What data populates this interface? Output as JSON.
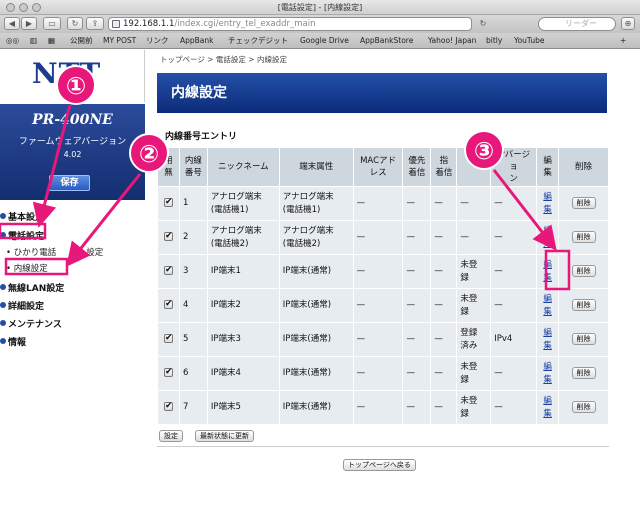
{
  "window": {
    "title": "[電話設定] - [内線設定]"
  },
  "toolbar": {
    "url": "192.168.1.1",
    "url_path": "/index.cgi/entry_tel_exaddr_main",
    "search_placeholder": "リーダー"
  },
  "bookmarks": [
    "公開前",
    "MY POST",
    "リンク",
    "AppBank",
    "チェックデジット",
    "Google Drive",
    "AppBankStore",
    "Yahoo! Japan",
    "bitly",
    "YouTube"
  ],
  "sidebar": {
    "logo": "NTT",
    "model": "PR-400NE",
    "fw_label": "ファームウェアバージョン",
    "fw_version": "4.02",
    "save_label": "保存",
    "nav": [
      "基本設定",
      "電話設定",
      "無線LAN設定",
      "詳細設定",
      "メンテナンス",
      "情報"
    ],
    "sub": [
      "ひかり電話",
      "設定",
      "内線設定"
    ]
  },
  "main": {
    "breadcrumb": "トップページ > 電話設定 > 内線設定",
    "title": "内線設定",
    "section": "内線番号エントリ",
    "headers": {
      "use1": "用",
      "use2": "無",
      "num1": "内線",
      "num2": "番号",
      "nick": "ニックネーム",
      "attr": "端末属性",
      "mac1": "MACアド",
      "mac2": "レス",
      "prio1": "優先",
      "prio2": "着信",
      "sh1": "指",
      "sh2": "着信",
      "reg": "",
      "ipv": "IPバージョ",
      "ipv2": "ン",
      "edit1": "編",
      "edit2": "集",
      "del": "削除"
    },
    "rows": [
      {
        "num": "1",
        "nick1": "アナログ端末",
        "nick2": "(電話機1)",
        "attr1": "アナログ端末",
        "attr2": "(電話機1)",
        "mac": "—",
        "prio": "—",
        "sh": "—",
        "reg1": "—",
        "reg2": "",
        "ipv": "—",
        "edit1": "編",
        "edit2": "集",
        "del": "削除"
      },
      {
        "num": "2",
        "nick1": "アナログ端末",
        "nick2": "(電話機2)",
        "attr1": "アナログ端末",
        "attr2": "(電話機2)",
        "mac": "—",
        "prio": "—",
        "sh": "—",
        "reg1": "—",
        "reg2": "",
        "ipv": "—",
        "edit1": "編",
        "edit2": "集",
        "del": "削除"
      },
      {
        "num": "3",
        "nick1": "IP端末1",
        "nick2": "",
        "attr1": "IP端末(通常)",
        "attr2": "",
        "mac": "—",
        "prio": "—",
        "sh": "—",
        "reg1": "未登",
        "reg2": "録",
        "ipv": "—",
        "edit1": "編",
        "edit2": "集",
        "del": "削除"
      },
      {
        "num": "4",
        "nick1": "IP端末2",
        "nick2": "",
        "attr1": "IP端末(通常)",
        "attr2": "",
        "mac": "—",
        "prio": "—",
        "sh": "—",
        "reg1": "未登",
        "reg2": "録",
        "ipv": "—",
        "edit1": "編",
        "edit2": "集",
        "del": "削除"
      },
      {
        "num": "5",
        "nick1": "IP端末3",
        "nick2": "",
        "attr1": "IP端末(通常)",
        "attr2": "",
        "mac": "—",
        "prio": "—",
        "sh": "—",
        "reg1": "登録",
        "reg2": "済み",
        "ipv": "IPv4",
        "edit1": "編",
        "edit2": "集",
        "del": "削除"
      },
      {
        "num": "6",
        "nick1": "IP端末4",
        "nick2": "",
        "attr1": "IP端末(通常)",
        "attr2": "",
        "mac": "—",
        "prio": "—",
        "sh": "—",
        "reg1": "未登",
        "reg2": "録",
        "ipv": "—",
        "edit1": "編",
        "edit2": "集",
        "del": "削除"
      },
      {
        "num": "7",
        "nick1": "IP端末5",
        "nick2": "",
        "attr1": "IP端末(通常)",
        "attr2": "",
        "mac": "—",
        "prio": "—",
        "sh": "—",
        "reg1": "未登",
        "reg2": "録",
        "ipv": "—",
        "edit1": "編",
        "edit2": "集",
        "del": "削除"
      }
    ],
    "set_label": "設定",
    "refresh_label": "最新状態に更新",
    "back_label": "トップページへ戻る"
  },
  "annotations": {
    "n1": "①",
    "n2": "②",
    "n3": "③",
    "color": "#e8177a"
  }
}
